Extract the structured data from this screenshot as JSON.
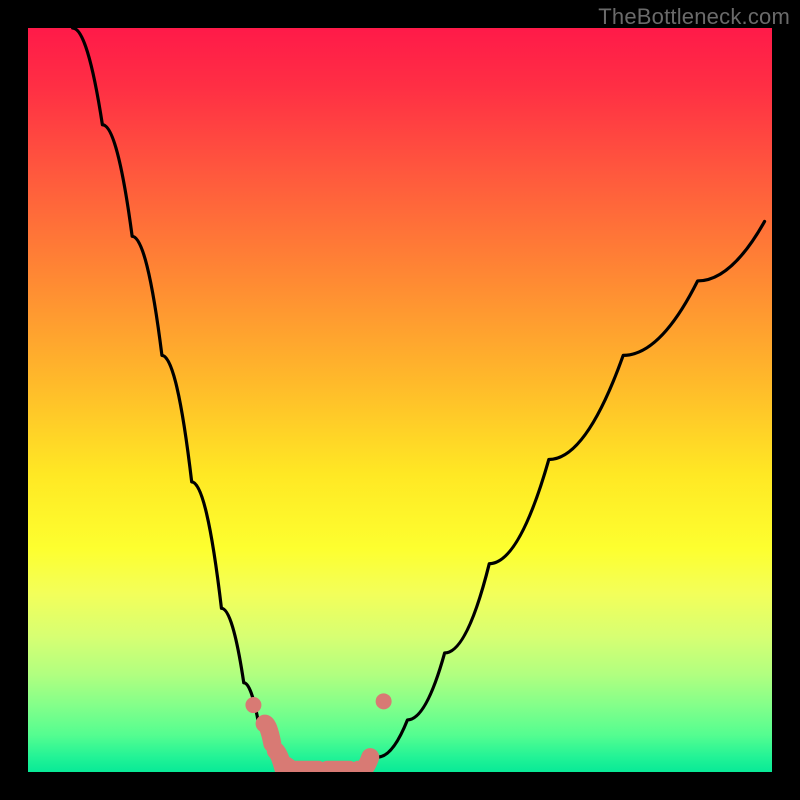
{
  "watermark": "TheBottleneck.com",
  "colors": {
    "page_bg": "#000000",
    "curve": "#000000",
    "beads": "#d87a74",
    "watermark": "#6a6a6a"
  },
  "chart_data": {
    "type": "line",
    "title": "",
    "xlabel": "",
    "ylabel": "",
    "xlim": [
      0,
      1
    ],
    "ylim": [
      0,
      1
    ],
    "series": [
      {
        "name": "left-curve",
        "x": [
          0.06,
          0.1,
          0.14,
          0.18,
          0.22,
          0.26,
          0.29,
          0.31,
          0.33,
          0.345,
          0.36
        ],
        "y": [
          1.0,
          0.87,
          0.72,
          0.56,
          0.39,
          0.22,
          0.12,
          0.065,
          0.03,
          0.01,
          0.003
        ]
      },
      {
        "name": "valley-floor",
        "x": [
          0.36,
          0.4,
          0.44
        ],
        "y": [
          0.003,
          0.001,
          0.003
        ]
      },
      {
        "name": "right-curve",
        "x": [
          0.44,
          0.47,
          0.51,
          0.56,
          0.62,
          0.7,
          0.8,
          0.9,
          0.99
        ],
        "y": [
          0.003,
          0.02,
          0.07,
          0.16,
          0.28,
          0.42,
          0.56,
          0.66,
          0.74
        ]
      }
    ],
    "markers": [
      {
        "name": "bead-left-upper",
        "x": 0.303,
        "y": 0.09
      },
      {
        "name": "bead-right-upper",
        "x": 0.478,
        "y": 0.095
      },
      {
        "name": "bead-segment",
        "x_range": [
          0.318,
          0.46
        ],
        "y_approx": 0.01
      }
    ],
    "gradient_stops": [
      {
        "pos": 0.0,
        "color": "#ff1a49"
      },
      {
        "pos": 0.2,
        "color": "#ff5a3d"
      },
      {
        "pos": 0.48,
        "color": "#ffbb2a"
      },
      {
        "pos": 0.7,
        "color": "#fdff2f"
      },
      {
        "pos": 0.91,
        "color": "#84ff8a"
      },
      {
        "pos": 1.0,
        "color": "#08ea97"
      }
    ]
  }
}
